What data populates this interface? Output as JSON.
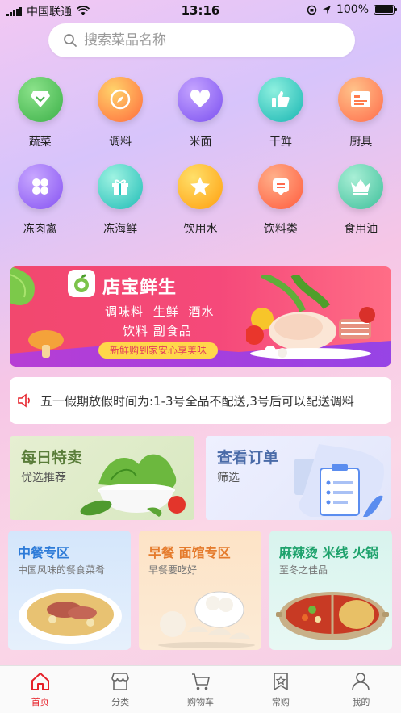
{
  "status": {
    "carrier": "中国联通",
    "time": "13:16",
    "battery": "100%"
  },
  "search": {
    "placeholder": "搜索菜品名称"
  },
  "categories": [
    {
      "label": "蔬菜",
      "icon": "diamond-icon",
      "color": "#58c45d"
    },
    {
      "label": "调料",
      "icon": "compass-icon",
      "color": "#ff8a3c"
    },
    {
      "label": "米面",
      "icon": "heart-icon",
      "color": "#9a6df5"
    },
    {
      "label": "干鲜",
      "icon": "thumbs-up-icon",
      "color": "#27c6c0"
    },
    {
      "label": "厨具",
      "icon": "card-icon",
      "color": "#ff7b4b"
    },
    {
      "label": "冻肉禽",
      "icon": "clover-icon",
      "color": "#9a6df5"
    },
    {
      "label": "冻海鲜",
      "icon": "gift-icon",
      "color": "#27c6c0"
    },
    {
      "label": "饮用水",
      "icon": "star-icon",
      "color": "#ffb016"
    },
    {
      "label": "饮料类",
      "icon": "message-icon",
      "color": "#ff6a4d"
    },
    {
      "label": "食用油",
      "icon": "crown-icon",
      "color": "#58c4a8"
    }
  ],
  "banner": {
    "title": "店宝鲜生",
    "line1": "调味料  生鲜  酒水",
    "line2": "饮料  副食品",
    "tag": "新鲜购到家安心享美味"
  },
  "notice": {
    "text": "五一假期放假时间为:1-3号全品不配送,3号后可以配送调料"
  },
  "promos": [
    {
      "title": "每日特卖",
      "subtitle": "优选推荐",
      "color": "#5a7d3a"
    },
    {
      "title": "查看订单",
      "subtitle": "筛选",
      "color": "#4a6ba8"
    }
  ],
  "zones": [
    {
      "title": "中餐专区",
      "subtitle": "中国风味的餐食菜肴",
      "color": "#2d7bd8"
    },
    {
      "title": "早餐  面馆专区",
      "subtitle": "早餐要吃好",
      "color": "#e57b2c"
    },
    {
      "title": "麻辣烫 米线 火锅",
      "subtitle": "至冬之佳品",
      "color": "#1ea26c"
    }
  ],
  "tabs": [
    {
      "label": "首页",
      "icon": "home-icon",
      "active": true
    },
    {
      "label": "分类",
      "icon": "store-icon",
      "active": false
    },
    {
      "label": "购物车",
      "icon": "cart-icon",
      "active": false
    },
    {
      "label": "常购",
      "icon": "bookmark-star-icon",
      "active": false
    },
    {
      "label": "我的",
      "icon": "user-icon",
      "active": false
    }
  ],
  "accent_color": "#e6212a"
}
